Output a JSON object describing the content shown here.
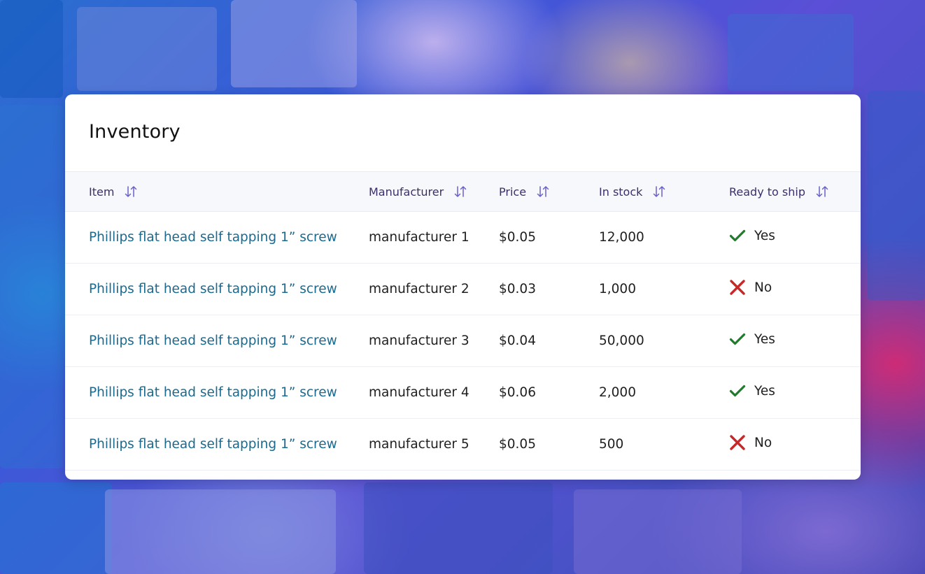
{
  "panel": {
    "title": "Inventory"
  },
  "table": {
    "columns": [
      {
        "label": "Item"
      },
      {
        "label": "Manufacturer"
      },
      {
        "label": "Price"
      },
      {
        "label": "In stock"
      },
      {
        "label": "Ready to ship"
      }
    ],
    "rows": [
      {
        "item": "Phillips flat head self tapping 1” screw",
        "manufacturer": "manufacturer 1",
        "price": "$0.05",
        "stock": "12,000",
        "ready": "Yes",
        "ready_icon": "check-icon"
      },
      {
        "item": "Phillips flat head self tapping 1” screw",
        "manufacturer": "manufacturer 2",
        "price": "$0.03",
        "stock": "1,000",
        "ready": "No",
        "ready_icon": "x-icon"
      },
      {
        "item": "Phillips flat head self tapping 1” screw",
        "manufacturer": "manufacturer 3",
        "price": "$0.04",
        "stock": "50,000",
        "ready": "Yes",
        "ready_icon": "check-icon"
      },
      {
        "item": "Phillips flat head self tapping 1” screw",
        "manufacturer": "manufacturer 4",
        "price": "$0.06",
        "stock": "2,000",
        "ready": "Yes",
        "ready_icon": "check-icon"
      },
      {
        "item": "Phillips flat head self tapping 1” screw",
        "manufacturer": "manufacturer 5",
        "price": "$0.05",
        "stock": "500",
        "ready": "No",
        "ready_icon": "x-icon"
      }
    ]
  },
  "colors": {
    "link": "#1a6a8f",
    "header_text": "#3b2f6b",
    "yes": "#1e7d2a",
    "no": "#c62828"
  },
  "icons": {
    "sort": "sort-arrows-icon",
    "yes": "check-icon",
    "no": "x-icon"
  }
}
